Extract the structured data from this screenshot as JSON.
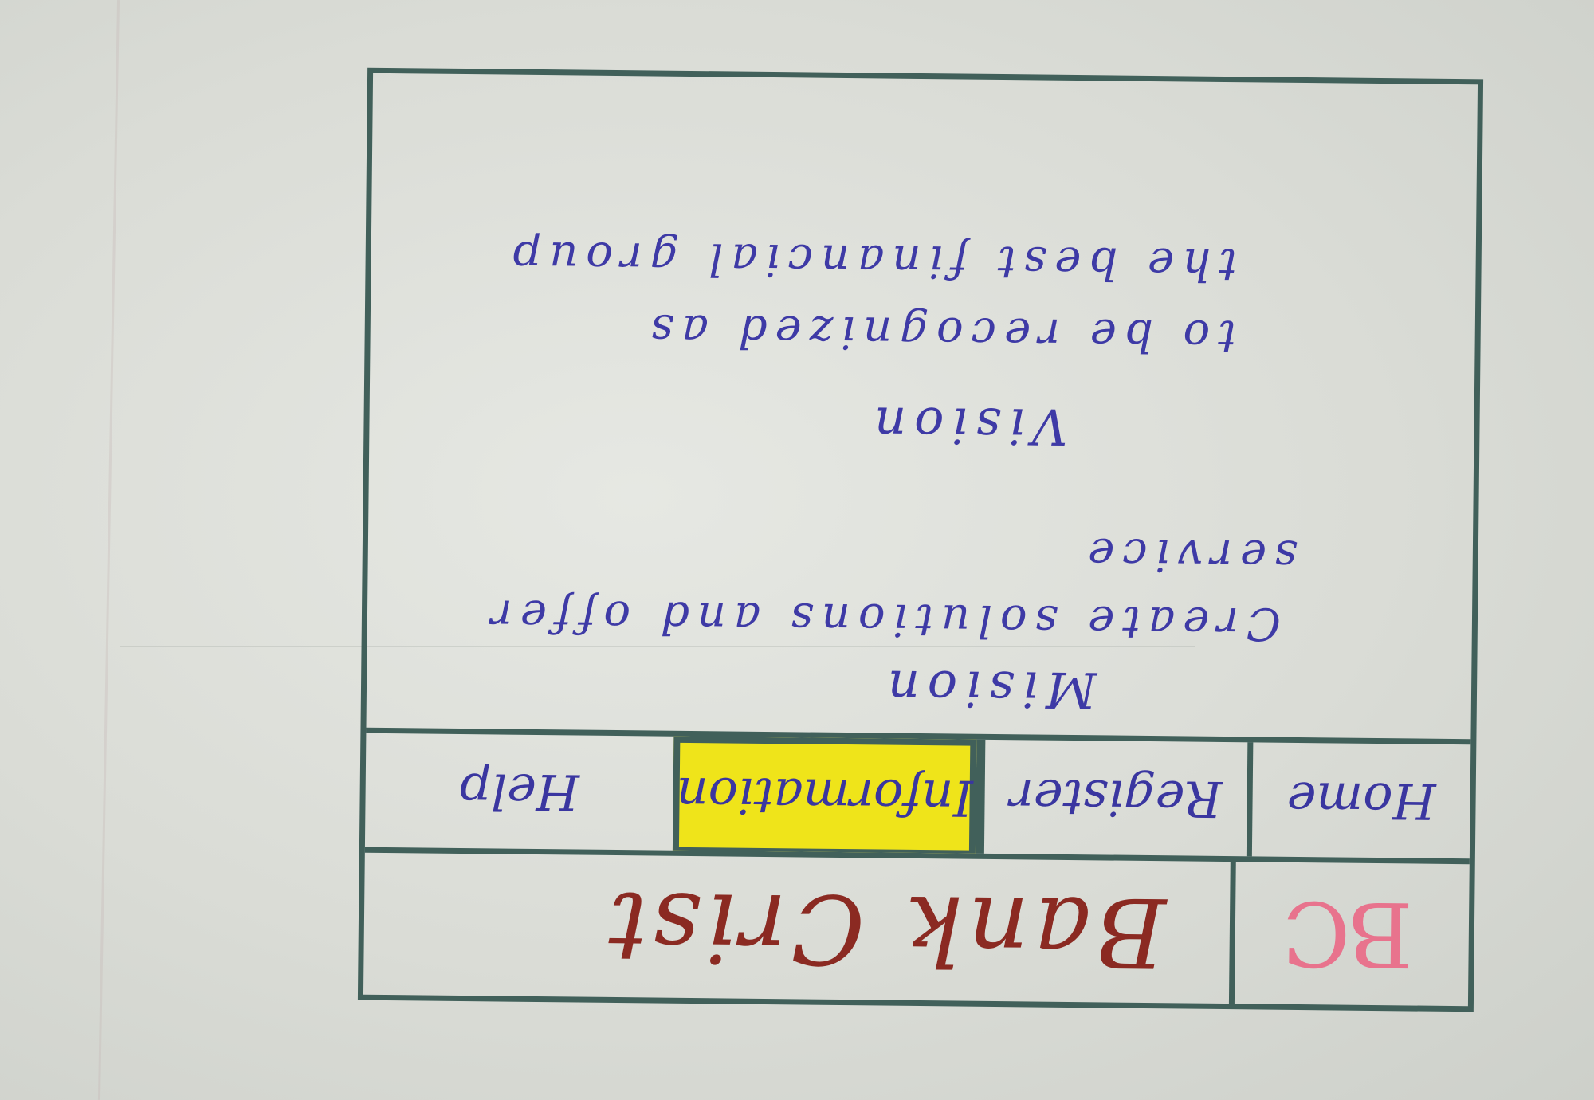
{
  "logo": {
    "text": "BC"
  },
  "brand": {
    "name": "Bank Crist"
  },
  "nav": {
    "items": [
      {
        "label": "Home"
      },
      {
        "label": "Register"
      },
      {
        "label": "Information",
        "active": true
      },
      {
        "label": "Help"
      }
    ],
    "active_color": "#efe41a"
  },
  "mission": {
    "title": "Mision",
    "text_line_1": "Create solutions and offer",
    "text_line_2": "service"
  },
  "vision": {
    "title": "Vision",
    "text_line_1": "to be recognized as",
    "text_line_2": "the best financial group"
  },
  "colors": {
    "frame": "#41605a",
    "ink_blue": "#3e3aa6",
    "brand_red": "#8b2a22",
    "logo_pink": "#e8738d"
  }
}
